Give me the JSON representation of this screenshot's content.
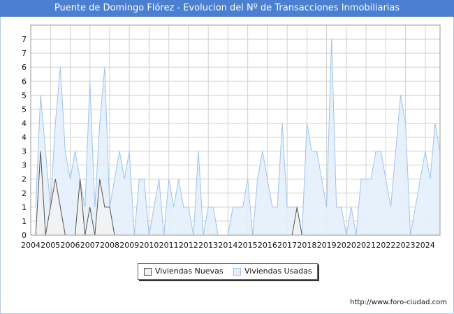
{
  "colors": {
    "title_bg": "#4a7fd1",
    "nuevas_fill": "#f2f2f2",
    "nuevas_line": "#555555",
    "usadas_fill": "#e3effb",
    "usadas_line": "#9fc3ec",
    "grid": "#d0d0d0"
  },
  "chart_data": {
    "type": "area",
    "title": "Puente de Domingo Flórez - Evolucion del Nº de Transacciones Inmobiliarias",
    "xlabel": "",
    "ylabel": "",
    "x_tick_labels": [
      "2004",
      "2005",
      "2006",
      "2007",
      "2008",
      "2009",
      "2010",
      "2011",
      "2012",
      "2013",
      "2014",
      "2015",
      "2016",
      "2017",
      "2018",
      "2019",
      "2020",
      "2021",
      "2022",
      "2023",
      "2024"
    ],
    "y_tick_labels": [
      "0",
      "1",
      "1",
      "2",
      "2",
      "3",
      "3",
      "4",
      "4",
      "5",
      "5",
      "6",
      "6",
      "7",
      "7"
    ],
    "ylim": [
      0,
      7.5
    ],
    "x_start": 2004,
    "x_end": 2024.75,
    "grid": true,
    "legend_position": "bottom-center",
    "source": "http://www.foro-ciudad.com",
    "series": [
      {
        "name": "Viviendas Nuevas",
        "x": [
          2004.25,
          2004.5,
          2004.75,
          2005.0,
          2005.25,
          2005.5,
          2005.75,
          2006.0,
          2006.25,
          2006.5,
          2006.75,
          2007.0,
          2007.25,
          2007.5,
          2007.75,
          2008.0,
          2008.25,
          2008.5,
          2017.25,
          2017.5,
          2017.75
        ],
        "values": [
          0,
          3,
          0,
          1,
          2,
          1,
          0,
          0,
          0,
          2,
          0,
          1,
          0,
          2,
          1,
          1,
          0,
          0,
          0,
          1,
          0
        ]
      },
      {
        "name": "Viviendas Usadas",
        "x": [
          2004.25,
          2004.5,
          2004.75,
          2005.0,
          2005.25,
          2005.5,
          2005.75,
          2006.0,
          2006.25,
          2006.5,
          2006.75,
          2007.0,
          2007.25,
          2007.5,
          2007.75,
          2008.0,
          2008.25,
          2008.5,
          2008.75,
          2009.0,
          2009.25,
          2009.5,
          2009.75,
          2010.0,
          2010.25,
          2010.5,
          2010.75,
          2011.0,
          2011.25,
          2011.5,
          2011.75,
          2012.0,
          2012.25,
          2012.5,
          2012.75,
          2013.0,
          2013.25,
          2013.5,
          2013.75,
          2014.0,
          2014.25,
          2014.5,
          2014.75,
          2015.0,
          2015.25,
          2015.5,
          2015.75,
          2016.0,
          2016.25,
          2016.5,
          2016.75,
          2017.0,
          2017.25,
          2017.5,
          2017.75,
          2018.0,
          2018.25,
          2018.5,
          2018.75,
          2019.0,
          2019.25,
          2019.5,
          2019.75,
          2020.0,
          2020.25,
          2020.5,
          2020.75,
          2021.0,
          2021.25,
          2021.5,
          2021.75,
          2022.0,
          2022.25,
          2022.5,
          2022.75,
          2023.0,
          2023.25,
          2023.5,
          2023.75,
          2024.0,
          2024.25,
          2024.5,
          2024.75
        ],
        "values": [
          1,
          5,
          3,
          1,
          4,
          6,
          3,
          2,
          3,
          2,
          1,
          5.5,
          1,
          4,
          6,
          1,
          2,
          3,
          2,
          3,
          0,
          2,
          2,
          0,
          1,
          2,
          0,
          2,
          1,
          2,
          1,
          1,
          0,
          3,
          0,
          1,
          1,
          0,
          0,
          0,
          1,
          1,
          1,
          2,
          0,
          2,
          3,
          2,
          1,
          1,
          4,
          1,
          1,
          1,
          0,
          4,
          3,
          3,
          2,
          1,
          7,
          1,
          1,
          0,
          1,
          0,
          2,
          2,
          2,
          3,
          3,
          2,
          1,
          3,
          5,
          4,
          0,
          1,
          2,
          3,
          2,
          4,
          3
        ]
      }
    ]
  },
  "legend": {
    "nuevas_label": "Viviendas Nuevas",
    "usadas_label": "Viviendas Usadas"
  }
}
